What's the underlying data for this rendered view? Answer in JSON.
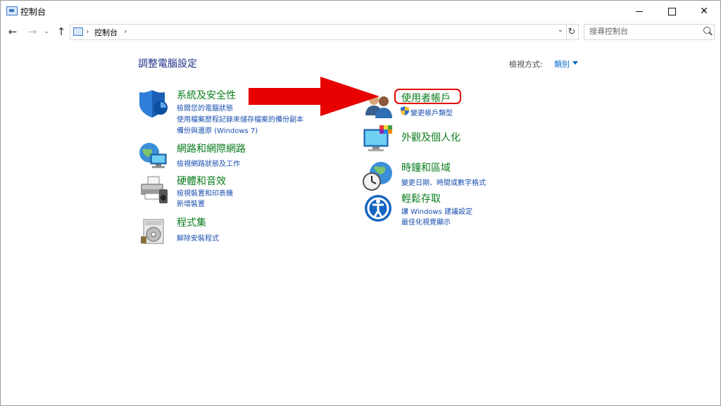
{
  "window": {
    "title": "控制台",
    "minimize": "—",
    "maximize": "□",
    "close": "✕"
  },
  "nav": {
    "back": "←",
    "forward": "→",
    "recent": "⌄",
    "up": "↑",
    "breadcrumb": "控制台",
    "separator": "›",
    "refresh": "↻",
    "dropdown": "⌄",
    "search_placeholder": "搜尋控制台"
  },
  "main": {
    "title": "調整電腦設定",
    "view_by_label": "檢視方式:",
    "view_by_value": "類別"
  },
  "categories_left": [
    {
      "id": "system-security",
      "icon": "shield-icon",
      "title": "系統及安全性",
      "links": [
        "檢閱您的電腦狀態",
        "使用檔案歷程記錄來儲存檔案的備份副本",
        "備份與還原 (Windows 7)"
      ]
    },
    {
      "id": "network-internet",
      "icon": "network-globe-icon",
      "title": "網路和網際網路",
      "links": [
        "檢視網路狀態及工作"
      ]
    },
    {
      "id": "hardware-sound",
      "icon": "printer-speaker-icon",
      "title": "硬體和音效",
      "links": [
        "檢視裝置和印表機",
        "新增裝置"
      ]
    },
    {
      "id": "programs",
      "icon": "programs-disc-icon",
      "title": "程式集",
      "links": [
        "解除安裝程式"
      ]
    }
  ],
  "categories_right": [
    {
      "id": "user-accounts",
      "icon": "users-icon",
      "title": "使用者帳戶",
      "links": [
        "變更帳戶類型"
      ]
    },
    {
      "id": "appearance",
      "icon": "monitor-palette-icon",
      "title": "外觀及個人化",
      "links": []
    },
    {
      "id": "clock-region",
      "icon": "clock-globe-icon",
      "title": "時鐘和區域",
      "links": [
        "變更日期、時間或數字格式"
      ]
    },
    {
      "id": "ease-of-access",
      "icon": "accessibility-icon",
      "title": "輕鬆存取",
      "links": [
        "讓 Windows 建議設定",
        "最佳化視覺顯示"
      ]
    }
  ],
  "annotation": {
    "arrow_color": "#e60000",
    "highlight_color": "#e40000"
  },
  "colors": {
    "category_title": "#0a7c1c",
    "link": "#1a4fb0",
    "page_title": "#1e3287"
  }
}
